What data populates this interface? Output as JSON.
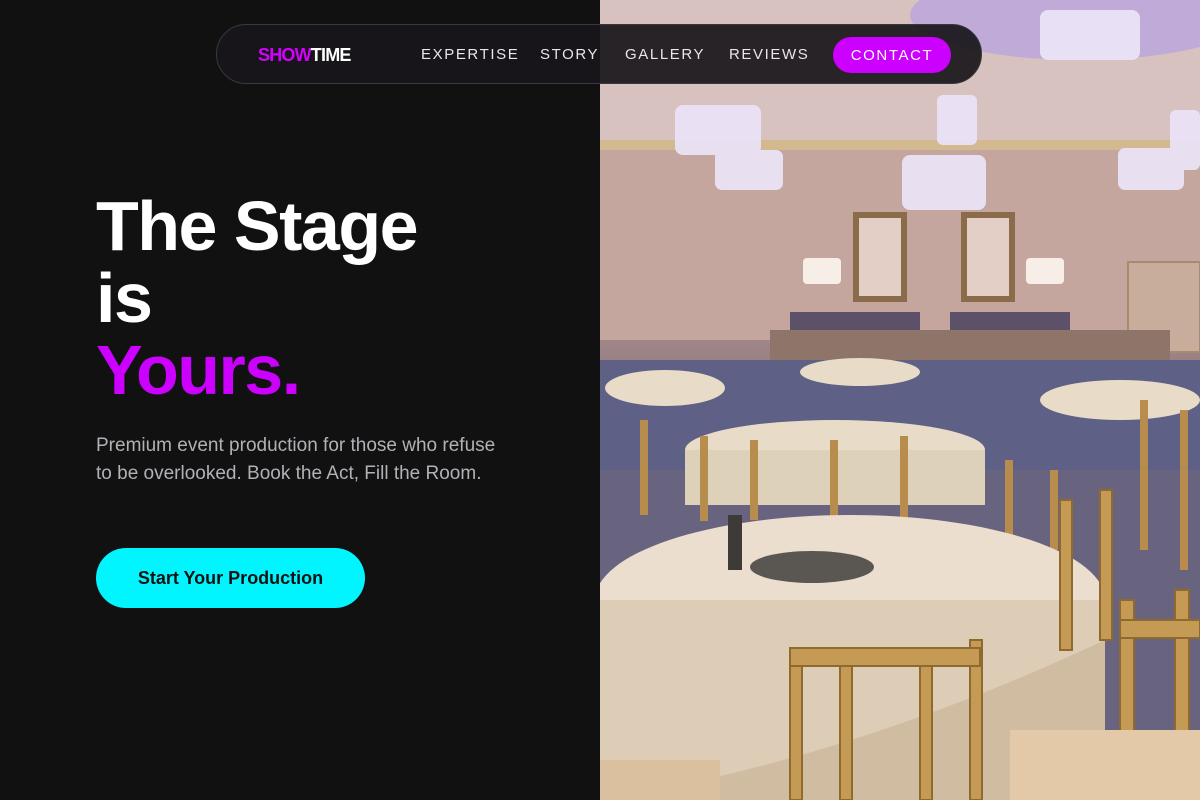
{
  "brand": {
    "part1": "SHOW",
    "part2": "TIME"
  },
  "nav": {
    "links": [
      "EXPERTISE",
      "STORY",
      "GALLERY",
      "REVIEWS"
    ],
    "contact_label": "CONTACT"
  },
  "hero": {
    "line1": "The Stage",
    "line2": "is",
    "accent_word": "Yours",
    "accent_dot": ".",
    "description": "Premium event production for those who refuse to be overlooked. Book the Act, Fill the Room.",
    "cta_label": "Start Your Production"
  },
  "colors": {
    "background": "#121112",
    "accent_magenta": "#cc00ff",
    "cta_cyan": "#00f5ff",
    "text_muted": "#b3b0b6"
  }
}
